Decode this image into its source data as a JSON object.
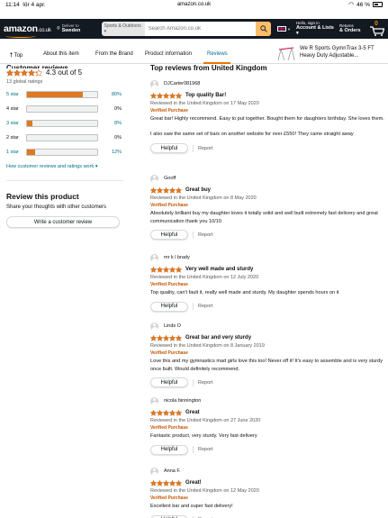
{
  "status_bar": {
    "time": "11:14",
    "date": "lör 4 apr.",
    "url": "amazon.co.uk",
    "battery": "46 %"
  },
  "header": {
    "logo": "amazon",
    "logo_tld": ".co.uk",
    "deliver_line1": "Deliver to",
    "deliver_line2": "Sweden",
    "search_category": "Sports & Outdoors ▾",
    "search_placeholder": "Search Amazon.co.uk",
    "account_line1": "Hello, sign in",
    "account_line2": "Account & Lists ▾",
    "returns_line1": "Returns",
    "returns_line2": "& Orders",
    "cart_count": "0"
  },
  "subnav": {
    "items": [
      "Top",
      "About this item",
      "From the Brand",
      "Product information",
      "Reviews"
    ],
    "active": "Reviews",
    "product_title": "We R Sports GymnTrax 3-5 FT Heavy Duty Adjustable..."
  },
  "summary": {
    "heading": "Customer reviews",
    "average_text": "4.3 out of 5",
    "average_value": 4.3,
    "global_ratings": "13 global ratings",
    "histogram": [
      {
        "label": "5 star",
        "percent": 80,
        "percent_text": "80%",
        "link": true
      },
      {
        "label": "4 star",
        "percent": 0,
        "percent_text": "0%",
        "link": false
      },
      {
        "label": "3 star",
        "percent": 8,
        "percent_text": "8%",
        "link": true
      },
      {
        "label": "2 star",
        "percent": 0,
        "percent_text": "0%",
        "link": false
      },
      {
        "label": "1 star",
        "percent": 12,
        "percent_text": "12%",
        "link": true
      }
    ],
    "how_link": "How customer reviews and ratings work ▾",
    "review_heading": "Review this product",
    "share_text": "Share your thoughts with other customers",
    "write_button": "Write a customer review"
  },
  "reviews_heading": "Top reviews from United Kingdom",
  "reviews": [
    {
      "author": "DJCarter081968",
      "rating": 5,
      "title": "Top quality Bar!",
      "date": "Reviewed in the United Kingdom on 17 May 2020",
      "verified": "Verified Purchase",
      "body": [
        "Great bar! Highly recommend. Easy to put together. Bought them for daughters birthday. She loves them.",
        "",
        "I also saw the same set of bars on another website for over £550! They came straight away"
      ]
    },
    {
      "author": "Gooff",
      "rating": 5,
      "title": "Great buy",
      "date": "Reviewed in the United Kingdom on 8 May 2020",
      "verified": "Verified Purchase",
      "body": [
        "Absolutely brilliant buy my daughter loves it totally solid and well built extremely fast delivery and great communication thank you 10/10"
      ]
    },
    {
      "author": "mr k l brady",
      "rating": 5,
      "title": "Very well made and sturdy",
      "date": "Reviewed in the United Kingdom on 12 July 2020",
      "verified": "Verified Purchase",
      "body": [
        "Top quality, can't fault it, really well made and sturdy. My daughter spends hours on it"
      ]
    },
    {
      "author": "Linds O",
      "rating": 5,
      "title": "Great bar and very sturdy",
      "date": "Reviewed in the United Kingdom on 8 January 2019",
      "verified": "Verified Purchase",
      "body": [
        "Love this and my gymnastics mad girls love this too! Never off it! It's easy to assemble and is very sturdy once built. Would definitely recommend."
      ]
    },
    {
      "author": "nicola binnington",
      "rating": 5,
      "title": "Great",
      "date": "Reviewed in the United Kingdom on 27 June 2020",
      "verified": "Verified Purchase",
      "body": [
        "Fantastic product, very sturdy. Very fast delivery"
      ]
    },
    {
      "author": "Anna F.",
      "rating": 5,
      "title": "Great!",
      "date": "Reviewed in the United Kingdom on 12 May 2020",
      "verified": "Verified Purchase",
      "body": [
        "Excellent bar and super fast delivery!"
      ]
    }
  ],
  "review_actions": {
    "helpful": "Helpful",
    "report": "Report"
  },
  "colors": {
    "star": "#de7921",
    "header_bg": "#131921",
    "link": "#007185",
    "verified": "#c45500",
    "search_button": "#febd69"
  },
  "icons": {
    "search": "magnifier-icon",
    "cart": "cart-icon",
    "flag": "uk-flag-icon"
  }
}
